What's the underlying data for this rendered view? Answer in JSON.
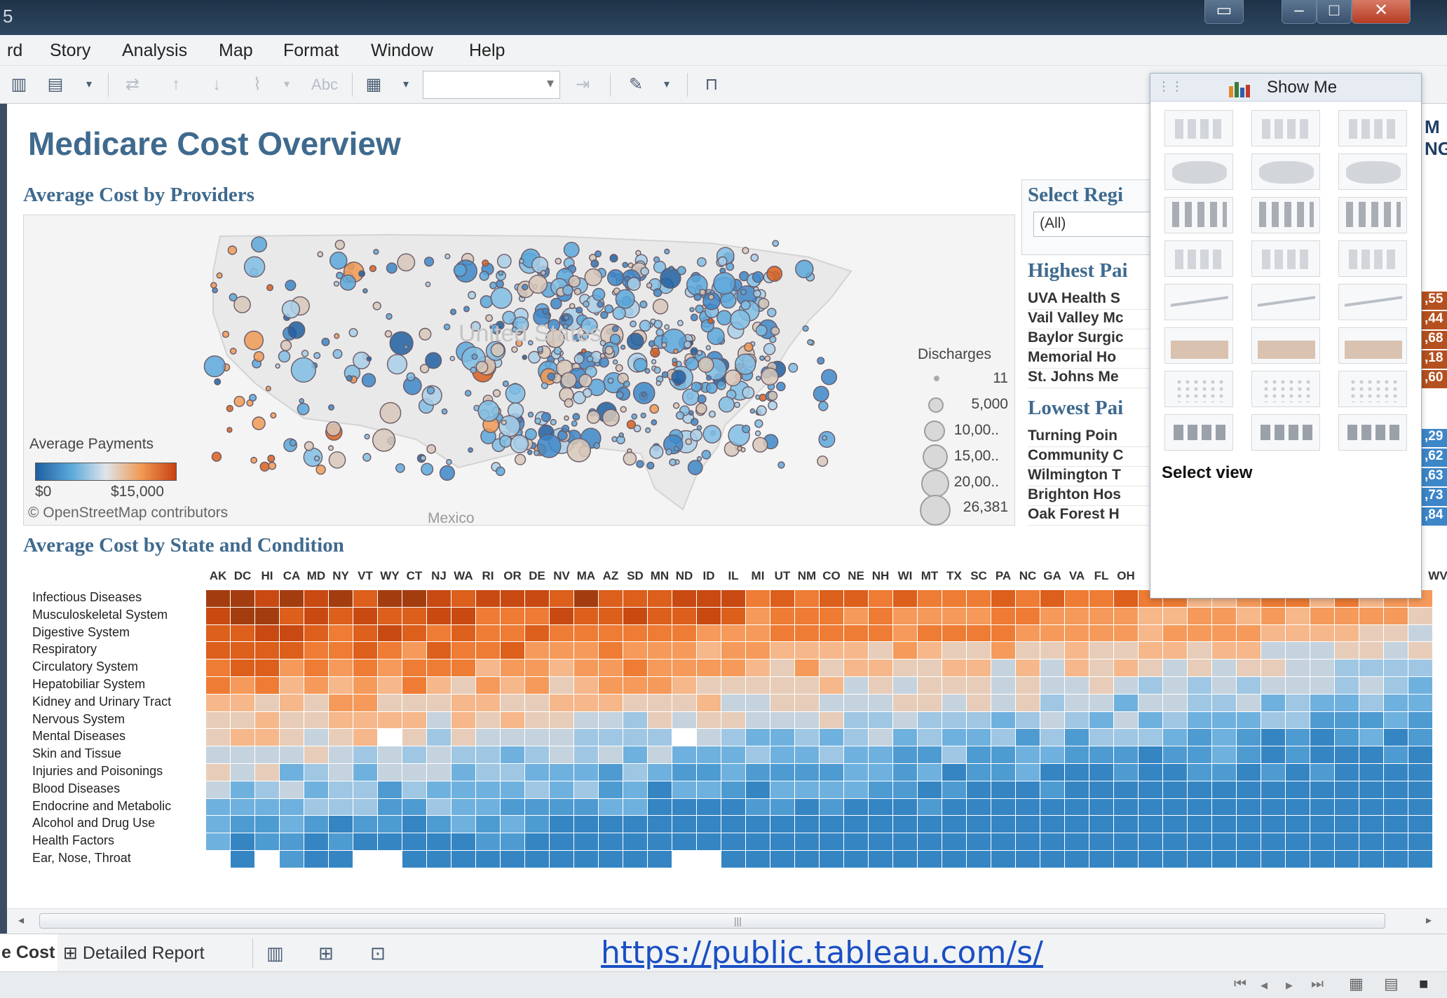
{
  "window": {
    "partial_title": "5",
    "buttons": {
      "restore_label": "▭",
      "minimize_label": "‒",
      "maximize_label": "□",
      "close_label": "✕"
    }
  },
  "menu": {
    "items": [
      "rd",
      "Story",
      "Analysis",
      "Map",
      "Format",
      "Window",
      "Help"
    ]
  },
  "toolbar": {
    "combo_value": "",
    "text_button_label": "Abc"
  },
  "dashboard": {
    "title": "Medicare Cost Overview",
    "map_section_title": "Average Cost  by Providers",
    "heatmap_section_title": "Average Cost by State and Condition",
    "select_region_title": "Select Regi",
    "region_value": "(All)",
    "highest_title": "Highest Pai",
    "lowest_title": "Lowest Pai",
    "highest_providers": [
      "UVA Health S",
      "Vail Valley Mc",
      "Baylor Surgic",
      "Memorial Ho",
      "St. Johns Me"
    ],
    "highest_values": [
      ",55",
      ",44",
      ",68",
      ",18",
      ",60"
    ],
    "lowest_providers": [
      "Turning Poin",
      "Community C",
      "Wilmington T",
      "Brighton Hos",
      "Oak Forest H"
    ],
    "lowest_values": [
      ",29",
      ",62",
      ",63",
      ",73",
      ",84"
    ],
    "right_edge_logo": "M\nNG"
  },
  "map": {
    "us_label": "United States",
    "mexico_label": "Mexico",
    "credit": "© OpenStreetMap contributors",
    "color_legend": {
      "title": "Average Payments",
      "min": "$0",
      "max": "$15,000"
    },
    "size_legend": {
      "title": "Discharges",
      "values": [
        "11",
        "5,000",
        "10,00..",
        "15,00..",
        "20,00..",
        "26,381"
      ]
    }
  },
  "heatmap": {
    "states": [
      "AK",
      "DC",
      "HI",
      "CA",
      "MD",
      "NY",
      "VT",
      "WY",
      "CT",
      "NJ",
      "WA",
      "RI",
      "OR",
      "DE",
      "NV",
      "MA",
      "AZ",
      "SD",
      "MN",
      "ND",
      "ID",
      "IL",
      "MI",
      "UT",
      "NM",
      "CO",
      "NE",
      "NH",
      "WI",
      "MT",
      "TX",
      "SC",
      "PA",
      "NC",
      "GA",
      "VA",
      "FL",
      "OH"
    ],
    "truncated_right_state": "WV",
    "conditions": [
      "Infectious Diseases",
      "Musculoskeletal System",
      "Digestive System",
      "Respiratory",
      "Circulatory System",
      "Hepatobiliar System",
      "Kidney and Urinary Tract",
      "Nervous System",
      "Mental Diseases",
      "Skin and Tissue",
      "Injuries and Poisonings",
      "Blood Diseases",
      "Endocrine and Metabolic",
      "Alcohol and Drug Use",
      "Health Factors",
      "Ear, Nose, Throat"
    ]
  },
  "show_me": {
    "title": "Show Me",
    "footer": "Select view",
    "chart_types": [
      "text-table",
      "heat-map",
      "highlight-table",
      "symbol-map",
      "filled-map",
      "pie-chart",
      "horizontal-bars",
      "stacked-bars",
      "side-by-side-bars",
      "treemap",
      "circle-views",
      "side-by-side-circles",
      "continuous-lines",
      "discrete-lines",
      "dual-lines",
      "area-continuous",
      "area-discrete",
      "dual-combination",
      "scatter-plot",
      "histogram",
      "box-and-whisker",
      "gantt",
      "bullet-graph",
      "packed-bubbles"
    ]
  },
  "tabs": {
    "cost_label": "e Cost",
    "detailed_label": "Detailed Report"
  },
  "url": "https://public.tableau.com/s/",
  "colors": {
    "accent_title": "#3f6a8e",
    "high_cost": "#c84210",
    "low_cost": "#1f6fb2"
  }
}
